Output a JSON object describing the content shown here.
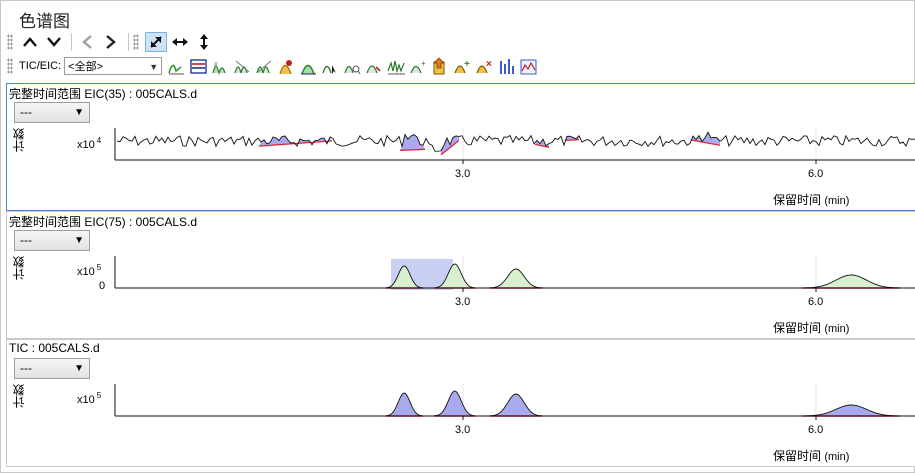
{
  "window": {
    "title": "色谱图"
  },
  "toolbar": {
    "tic_eic_label": "TIC/EIC:",
    "tic_eic_value": "<全部>",
    "nav_buttons": [
      "previous-chromatogram",
      "next-chromatogram",
      "back",
      "forward"
    ],
    "zoom_buttons": [
      "autoscale-both",
      "autoscale-x",
      "autoscale-y"
    ],
    "tool_icons": [
      "extract-chromatogram",
      "chromatogram-list",
      "integrate",
      "integrate-all",
      "clear-integration",
      "peak-purity",
      "select-peak",
      "zoom-peak",
      "smooth",
      "baseline",
      "deconvolution",
      "add-peak",
      "export",
      "add-to-list",
      "delete-from-list",
      "peak-table",
      "compare"
    ]
  },
  "panels": [
    {
      "title": "完整时间范围 EIC(35) : 005CALS.d",
      "combo_value": "---",
      "y_label": "计数",
      "y_multiplier": "x10",
      "y_exponent": "4",
      "y_ticks": [],
      "x_ticks": [
        "3.0",
        "6.0"
      ],
      "x_label": "保留时间",
      "x_unit": "(min)",
      "selected": true
    },
    {
      "title": "完整时间范围 EIC(75) : 005CALS.d",
      "combo_value": "---",
      "y_label": "计数",
      "y_multiplier": "x10",
      "y_exponent": "5",
      "y_ticks": [
        "0"
      ],
      "x_ticks": [
        "3.0",
        "6.0"
      ],
      "x_label": "保留时间",
      "x_unit": "(min)",
      "selected": false
    },
    {
      "title": "TIC : 005CALS.d",
      "combo_value": "---",
      "y_label": "计数",
      "y_multiplier": "x10",
      "y_exponent": "5",
      "y_ticks": [],
      "x_ticks": [
        "3.0",
        "6.0"
      ],
      "x_label": "保留时间",
      "x_unit": "(min)",
      "selected": false
    }
  ],
  "colors": {
    "peak_fill_eic35": "#a9a9ee",
    "peak_fill_eic75": "#d8f0d0",
    "peak_fill_tic": "#a9a9ee",
    "baseline": "#e0202a",
    "selection": "#c8cff3"
  }
}
